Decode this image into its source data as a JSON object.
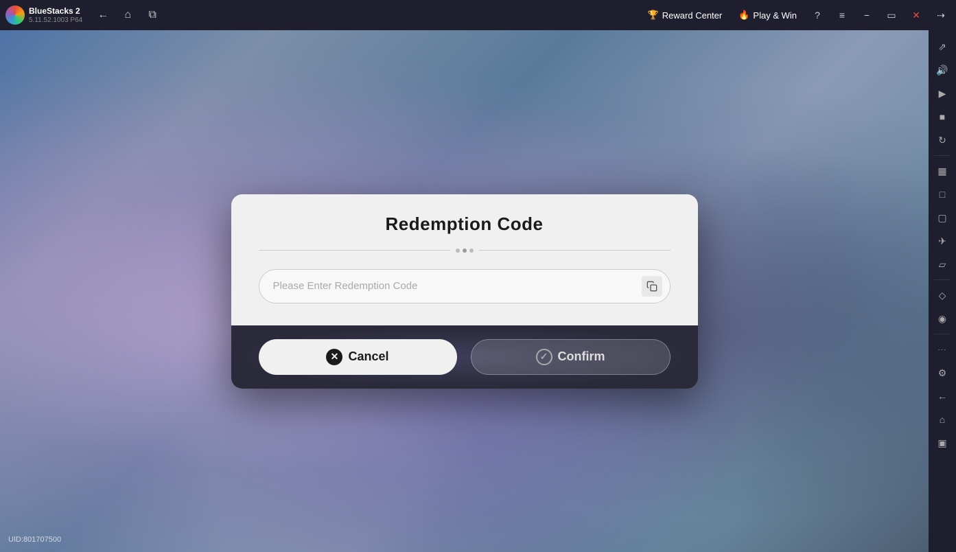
{
  "app": {
    "name": "BlueStacks 2",
    "version": "5.11.52.1003  P64"
  },
  "topbar": {
    "back_label": "←",
    "home_label": "⌂",
    "copy_label": "⧉",
    "reward_center_label": "Reward Center",
    "play_win_label": "Play & Win",
    "help_label": "?",
    "menu_label": "≡",
    "minimize_label": "−",
    "restore_label": "▭",
    "close_label": "✕",
    "expand_label": "⤢"
  },
  "sidebar": {
    "icons": [
      {
        "name": "fullscreen-icon",
        "symbol": "⤢"
      },
      {
        "name": "volume-icon",
        "symbol": "🔊"
      },
      {
        "name": "video-icon",
        "symbol": "▶"
      },
      {
        "name": "screenshot-icon",
        "symbol": "📷"
      },
      {
        "name": "rotate-icon",
        "symbol": "↺"
      },
      {
        "name": "layers-icon",
        "symbol": "⊞"
      },
      {
        "name": "book-icon",
        "symbol": "📖"
      },
      {
        "name": "camera2-icon",
        "symbol": "⬛"
      },
      {
        "name": "folder-icon",
        "symbol": "📁"
      },
      {
        "name": "gamepad-icon",
        "symbol": "✈"
      },
      {
        "name": "controller-icon",
        "symbol": "⬡"
      },
      {
        "name": "tag-icon",
        "symbol": "🏷"
      },
      {
        "name": "pin-icon",
        "symbol": "📍"
      },
      {
        "name": "more-icon",
        "symbol": "···"
      },
      {
        "name": "settings-icon",
        "symbol": "⚙"
      },
      {
        "name": "back2-icon",
        "symbol": "←"
      },
      {
        "name": "home2-icon",
        "symbol": "⌂"
      },
      {
        "name": "bottom-icon",
        "symbol": "⬜"
      }
    ]
  },
  "uid": {
    "label": "UID:801707500"
  },
  "modal": {
    "title": "Redemption Code",
    "divider_dots": 3,
    "input_placeholder": "Please Enter Redemption Code",
    "cancel_label": "Cancel",
    "confirm_label": "Confirm"
  }
}
